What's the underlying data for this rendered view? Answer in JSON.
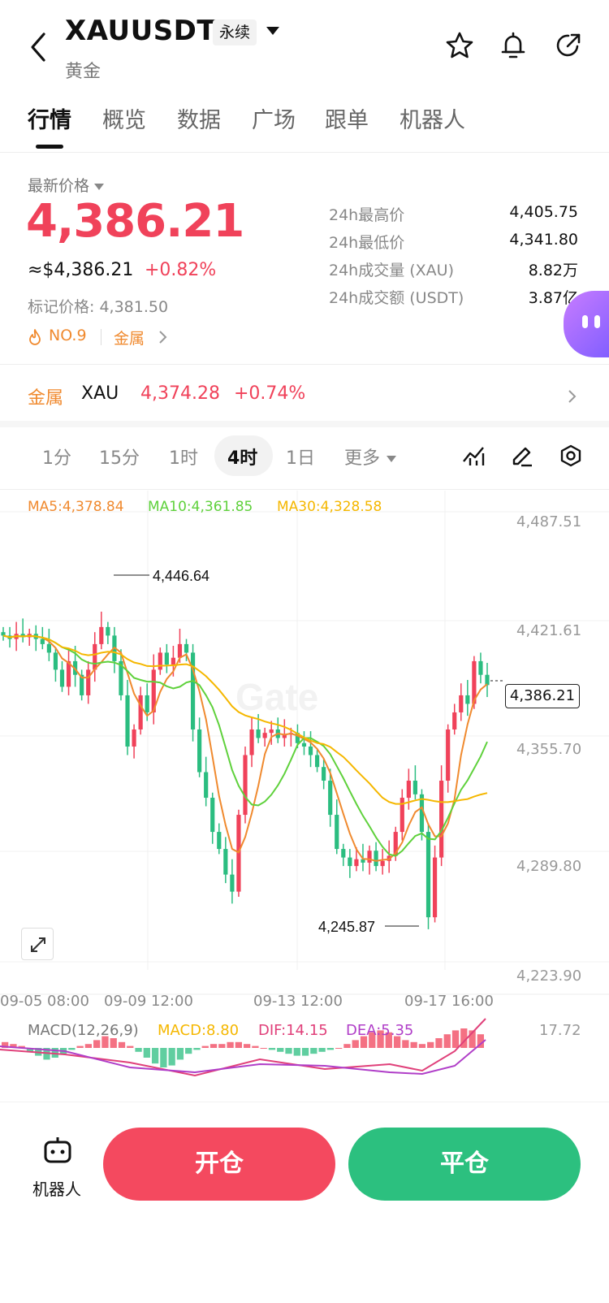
{
  "header": {
    "symbol": "XAUUSDT",
    "contract_type": "永续",
    "subtitle": "黄金"
  },
  "tabs": [
    "行情",
    "概览",
    "数据",
    "广场",
    "跟单",
    "机器人"
  ],
  "price": {
    "label": "最新价格",
    "last": "4,386.21",
    "usd": "≈$4,386.21",
    "change": "+0.82%",
    "mark": "标记价格: 4,381.50",
    "rank": "NO.9",
    "category": "金属"
  },
  "stats": [
    {
      "label": "24h最高价",
      "value": "4,405.75"
    },
    {
      "label": "24h最低价",
      "value": "4,341.80"
    },
    {
      "label": "24h成交量 (XAU)",
      "value": "8.82万"
    },
    {
      "label": "24h成交额 (USDT)",
      "value": "3.87亿"
    }
  ],
  "metal_row": {
    "category": "金属",
    "symbol": "XAU",
    "price": "4,374.28",
    "change": "+0.74%"
  },
  "periods": {
    "items": [
      "1分",
      "15分",
      "1时",
      "4时",
      "1日",
      "更多"
    ],
    "active": "4时"
  },
  "ma": {
    "ma5": "MA5:4,378.84",
    "ma10": "MA10:4,361.85",
    "ma30": "MA30:4,328.58"
  },
  "chart_data": {
    "type": "candlestick",
    "y_axis_labels": [
      "4,487.51",
      "4,421.61",
      "4,355.70",
      "4,289.80",
      "4,223.90"
    ],
    "ylim": [
      4223.9,
      4487.51
    ],
    "x_axis_labels": [
      "09-05 08:00",
      "09-09 12:00",
      "09-13 12:00",
      "09-17 16:00"
    ],
    "high_label": "4,446.64",
    "low_label": "4,245.87",
    "current_price": "4,386.21",
    "watermark": "Gate",
    "colors": {
      "up": "#2bbd80",
      "down": "#f0425a",
      "ma5": "#f08a2f",
      "ma10": "#5fd13c",
      "ma30": "#f5b700"
    }
  },
  "macd": {
    "title": "MACD(12,26,9)",
    "macd": "MACD:8.80",
    "dif": "DIF:14.15",
    "dea": "DEA:5.35",
    "top_value": "17.72"
  },
  "bottom": {
    "robot_label": "机器人",
    "open_label": "开仓",
    "close_label": "平仓"
  }
}
